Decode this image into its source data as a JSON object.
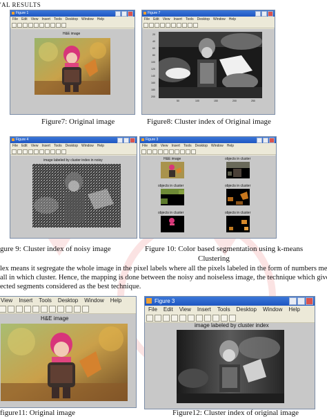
{
  "section_heading": "'AL RESULTS",
  "captions": {
    "fig7": "Figure7: Original image",
    "fig8": "Figure8: Cluster index of Original image",
    "fig9": "gure 9: Cluster index of noisy image",
    "fig10": "Figure 10: Color based segmentation using k-means",
    "fig10_cont": "Clustering",
    "fig11": "figure11: Original image",
    "fig12": "Figure12: Cluster index of original image"
  },
  "paragraph": [
    "lex means it segregate the whole image in the pixel labels where all the pixels labeled in the form of numbers means",
    "all in which cluster. Hence, the mapping is done between the noisy and noiseless image, the technique which gives",
    "ected segments considered as the best technique."
  ],
  "figures": {
    "w1": {
      "title": "Figure 1",
      "menu": [
        "File",
        "Edit",
        "View",
        "Insert",
        "Tools",
        "Desktop",
        "Window",
        "Help"
      ],
      "plot_title": "H&E image"
    },
    "w2": {
      "title": "Figure 7",
      "menu": [
        "File",
        "Edit",
        "View",
        "Insert",
        "Tools",
        "Desktop",
        "Window",
        "Help"
      ],
      "y_ticks": [
        "20",
        "40",
        "60",
        "80",
        "100",
        "120",
        "140",
        "160",
        "180",
        "200"
      ],
      "x_ticks": [
        "50",
        "100",
        "150",
        "200",
        "250"
      ]
    },
    "w3": {
      "title": "Figure 4",
      "menu": [
        "File",
        "Edit",
        "View",
        "Insert",
        "Tools",
        "Desktop",
        "Window",
        "Help"
      ],
      "plot_title": "image labeled by cluster index in noisy"
    },
    "w4": {
      "title": "Figure 3",
      "menu": [
        "File",
        "Edit",
        "View",
        "Insert",
        "Tools",
        "Desktop",
        "Window",
        "Help"
      ],
      "panels": [
        "H&E image",
        "objects in cluster",
        "objects in cluster",
        "objects in cluster",
        "objects in cluster",
        "objects in cluster"
      ]
    },
    "w5": {
      "menu": [
        "View",
        "Insert",
        "Tools",
        "Desktop",
        "Window",
        "Help"
      ],
      "plot_title": "H&E image"
    },
    "w6": {
      "title": "Figure 3",
      "menu": [
        "File",
        "Edit",
        "View",
        "Insert",
        "Tools",
        "Desktop",
        "Window",
        "Help"
      ],
      "plot_title": "image labeled by cluster index"
    }
  }
}
